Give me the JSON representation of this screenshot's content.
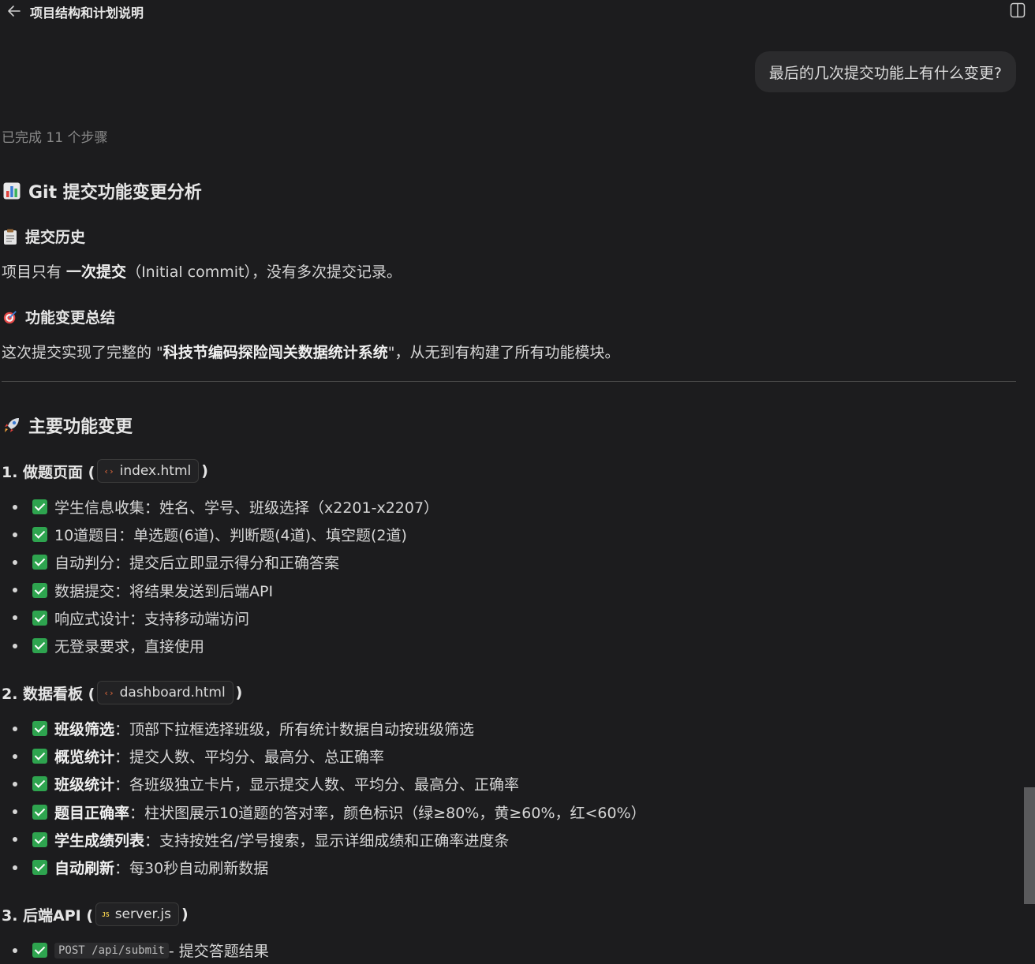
{
  "header": {
    "title": "项目结构和计划说明"
  },
  "user_message": "最后的几次提交功能上有什么变更?",
  "steps_status": "已完成 11 个步骤",
  "analysis": {
    "title": "Git 提交功能变更分析",
    "history_heading": "提交历史",
    "history_pre": "项目只有 ",
    "history_bold": "一次提交",
    "history_post": "（Initial commit），没有多次提交记录。",
    "summary_heading": "功能变更总结",
    "summary_pre": "这次提交实现了完整的 \"",
    "summary_bold": "科技节编码探险闯关数据统计系统",
    "summary_post": "\"，从无到有构建了所有功能模块。"
  },
  "main_changes": {
    "title": "主要功能变更",
    "sections": [
      {
        "label": "1. 做题页面 (",
        "file": "index.html",
        "close": ")",
        "items": [
          {
            "label": "",
            "text": "学生信息收集：姓名、学号、班级选择（x2201-x2207）"
          },
          {
            "label": "",
            "text": "10道题目：单选题(6道)、判断题(4道)、填空题(2道)"
          },
          {
            "label": "",
            "text": "自动判分：提交后立即显示得分和正确答案"
          },
          {
            "label": "",
            "text": "数据提交：将结果发送到后端API"
          },
          {
            "label": "",
            "text": "响应式设计：支持移动端访问"
          },
          {
            "label": "",
            "text": "无登录要求，直接使用"
          }
        ]
      },
      {
        "label": "2. 数据看板 (",
        "file": "dashboard.html",
        "close": ")",
        "items": [
          {
            "label": "班级筛选",
            "text": "：顶部下拉框选择班级，所有统计数据自动按班级筛选"
          },
          {
            "label": "概览统计",
            "text": "：提交人数、平均分、最高分、总正确率"
          },
          {
            "label": "班级统计",
            "text": "：各班级独立卡片，显示提交人数、平均分、最高分、正确率"
          },
          {
            "label": "题目正确率",
            "text": "：柱状图展示10道题的答对率，颜色标识（绿≥80%，黄≥60%，红<60%）"
          },
          {
            "label": "学生成绩列表",
            "text": "：支持按姓名/学号搜索，显示详细成绩和正确率进度条"
          },
          {
            "label": "自动刷新",
            "text": "：每30秒自动刷新数据"
          }
        ]
      },
      {
        "label": "3. 后端API (",
        "file": "server.js",
        "close": ")",
        "items": [
          {
            "code": "POST /api/submit",
            "text": " - 提交答题结果"
          }
        ]
      }
    ]
  },
  "icons": {
    "chip_html": "html-file-icon",
    "chip_js": "js-file-icon",
    "js_glyph": "JS",
    "html_glyph": "‹›"
  }
}
